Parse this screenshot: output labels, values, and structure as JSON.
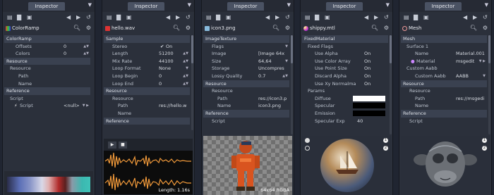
{
  "inspector_tab": "Inspector",
  "panels": [
    {
      "title": "ColorRamp",
      "rows": [
        {
          "type": "section",
          "label": "ColorRamp"
        },
        {
          "label": "Offsets",
          "value": "0"
        },
        {
          "label": "Colors",
          "value": "0"
        },
        {
          "type": "section",
          "label": "Resource"
        },
        {
          "type": "sub",
          "label": "Resource"
        },
        {
          "type": "sub2",
          "label": "Path"
        },
        {
          "type": "sub2",
          "label": "Name"
        },
        {
          "type": "section",
          "label": "Reference"
        },
        {
          "type": "sub",
          "label": "Script"
        },
        {
          "type": "sub2",
          "label": "Script",
          "value": "<null>"
        }
      ]
    },
    {
      "title": "hello.wav",
      "rows": [
        {
          "type": "section",
          "label": "Sample"
        },
        {
          "label": "Stereo",
          "value": "On"
        },
        {
          "label": "Length",
          "value": "51200"
        },
        {
          "label": "Mix Rate",
          "value": "44100"
        },
        {
          "label": "Loop Format",
          "value": "None"
        },
        {
          "label": "Loop Begin",
          "value": "0"
        },
        {
          "label": "Loop End",
          "value": "0"
        },
        {
          "type": "section",
          "label": "Resource"
        },
        {
          "type": "sub",
          "label": "Resource"
        },
        {
          "type": "sub2",
          "label": "Path",
          "value": "res://hello.w"
        },
        {
          "type": "sub2",
          "label": "Name"
        },
        {
          "type": "section",
          "label": "Reference"
        }
      ],
      "length_label": "Length: 1.16s"
    },
    {
      "title": "icon3.png",
      "rows": [
        {
          "type": "section",
          "label": "ImageTexture"
        },
        {
          "label": "Flags"
        },
        {
          "label": "Image",
          "value": "[Image 64x"
        },
        {
          "label": "Size",
          "value": "64,64"
        },
        {
          "label": "Storage",
          "value": "Uncompres"
        },
        {
          "label": "Lossy Quality",
          "value": "0.7"
        },
        {
          "type": "section",
          "label": "Resource"
        },
        {
          "type": "sub",
          "label": "Resource"
        },
        {
          "type": "sub2",
          "label": "Path",
          "value": "res://icon3.p"
        },
        {
          "type": "sub2",
          "label": "Name",
          "value": "icon3.png"
        },
        {
          "type": "section",
          "label": "Reference"
        },
        {
          "type": "sub",
          "label": "Script"
        }
      ],
      "image_label": "64x64 RGBA"
    },
    {
      "title": "shippy.mtl",
      "rows": [
        {
          "type": "section",
          "label": "FixedMaterial"
        },
        {
          "type": "sub",
          "label": "Fixed Flags"
        },
        {
          "type": "sub2",
          "label": "Use Alpha",
          "value": "On"
        },
        {
          "type": "sub2",
          "label": "Use Color Array",
          "value": "On"
        },
        {
          "type": "sub2",
          "label": "Use Point Size",
          "value": "On"
        },
        {
          "type": "sub2",
          "label": "Discard Alpha",
          "value": "On"
        },
        {
          "type": "sub2",
          "label": "Use Xy Normalma",
          "value": "On"
        },
        {
          "type": "sub",
          "label": "Params"
        },
        {
          "type": "sub2",
          "label": "Diffuse",
          "swatch": "#ffffff"
        },
        {
          "type": "sub2",
          "label": "Specular",
          "swatch": "#000000"
        },
        {
          "type": "sub2",
          "label": "Emission",
          "swatch": "#000000"
        },
        {
          "type": "sub2",
          "label": "Specular Exp",
          "value": "40"
        }
      ]
    },
    {
      "title": "Mesh",
      "rows": [
        {
          "type": "section",
          "label": "Mesh"
        },
        {
          "type": "sub",
          "label": "Surface 1"
        },
        {
          "type": "sub2",
          "label": "Name",
          "value": "Material.001"
        },
        {
          "type": "sub2",
          "label": "Material",
          "value": "msgedit"
        },
        {
          "type": "sub",
          "label": "Custom Aabb"
        },
        {
          "type": "sub2",
          "label": "Custom Aabb",
          "value": "AABB"
        },
        {
          "type": "section",
          "label": "Resource"
        },
        {
          "type": "sub",
          "label": "Resource"
        },
        {
          "type": "sub2",
          "label": "Path",
          "value": "res://msgedi"
        },
        {
          "type": "sub2",
          "label": "Name"
        },
        {
          "type": "section",
          "label": "Reference"
        },
        {
          "type": "sub",
          "label": "Script"
        }
      ]
    }
  ],
  "icons": [
    "new-icon",
    "open-icon",
    "save-icon",
    "back-icon",
    "forward-icon",
    "history-icon",
    "search-icon",
    "gear-icon"
  ],
  "colors": {
    "bg": "#202531",
    "panel": "#2b303b",
    "section": "#3a4150",
    "tab": "#4a5263"
  }
}
